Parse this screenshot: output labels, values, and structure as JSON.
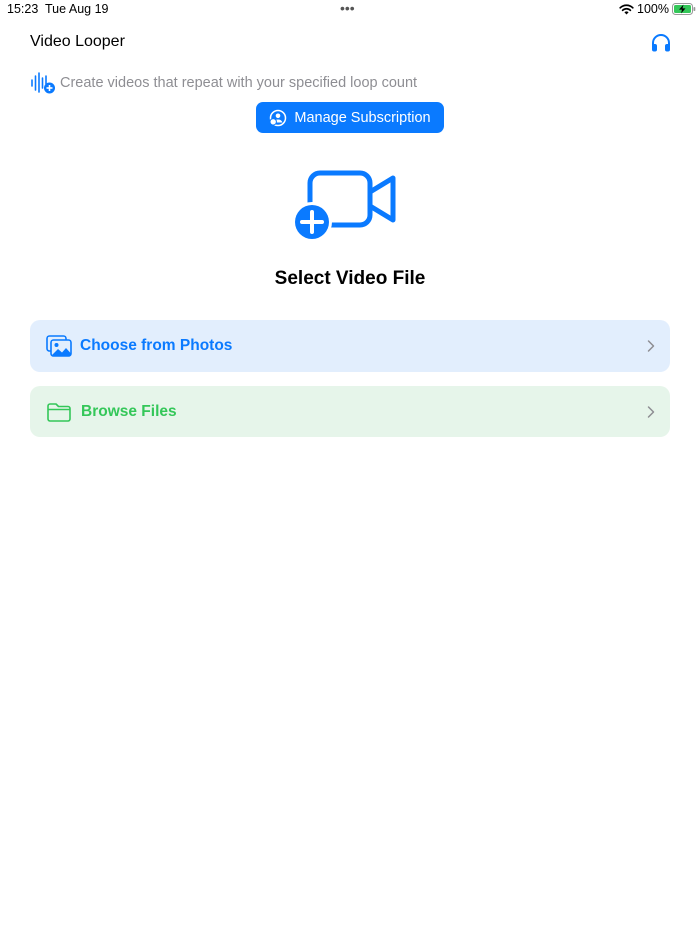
{
  "status_bar": {
    "time": "15:23",
    "date": "Tue Aug 19",
    "battery_percent": "100%",
    "multitask_dots": "•••"
  },
  "nav": {
    "title": "Video Looper",
    "headphones_icon": "headphones-icon"
  },
  "subtitle": {
    "icon": "waveform-plus-icon",
    "text": "Create videos that repeat with your specified loop count"
  },
  "subscription_button": {
    "icon": "person-badge-icon",
    "label": "Manage Subscription"
  },
  "hero": {
    "icon": "video-plus-icon",
    "title": "Select Video File"
  },
  "options": [
    {
      "icon": "photo-stack-icon",
      "label": "Choose from Photos",
      "accent": "#0a7aff",
      "background": "#e2eefd"
    },
    {
      "icon": "folder-icon",
      "label": "Browse Files",
      "accent": "#34c759",
      "background": "#e6f5ea"
    }
  ],
  "colors": {
    "primary": "#0a7aff",
    "success": "#34c759",
    "secondary_text": "#8e8e93"
  }
}
